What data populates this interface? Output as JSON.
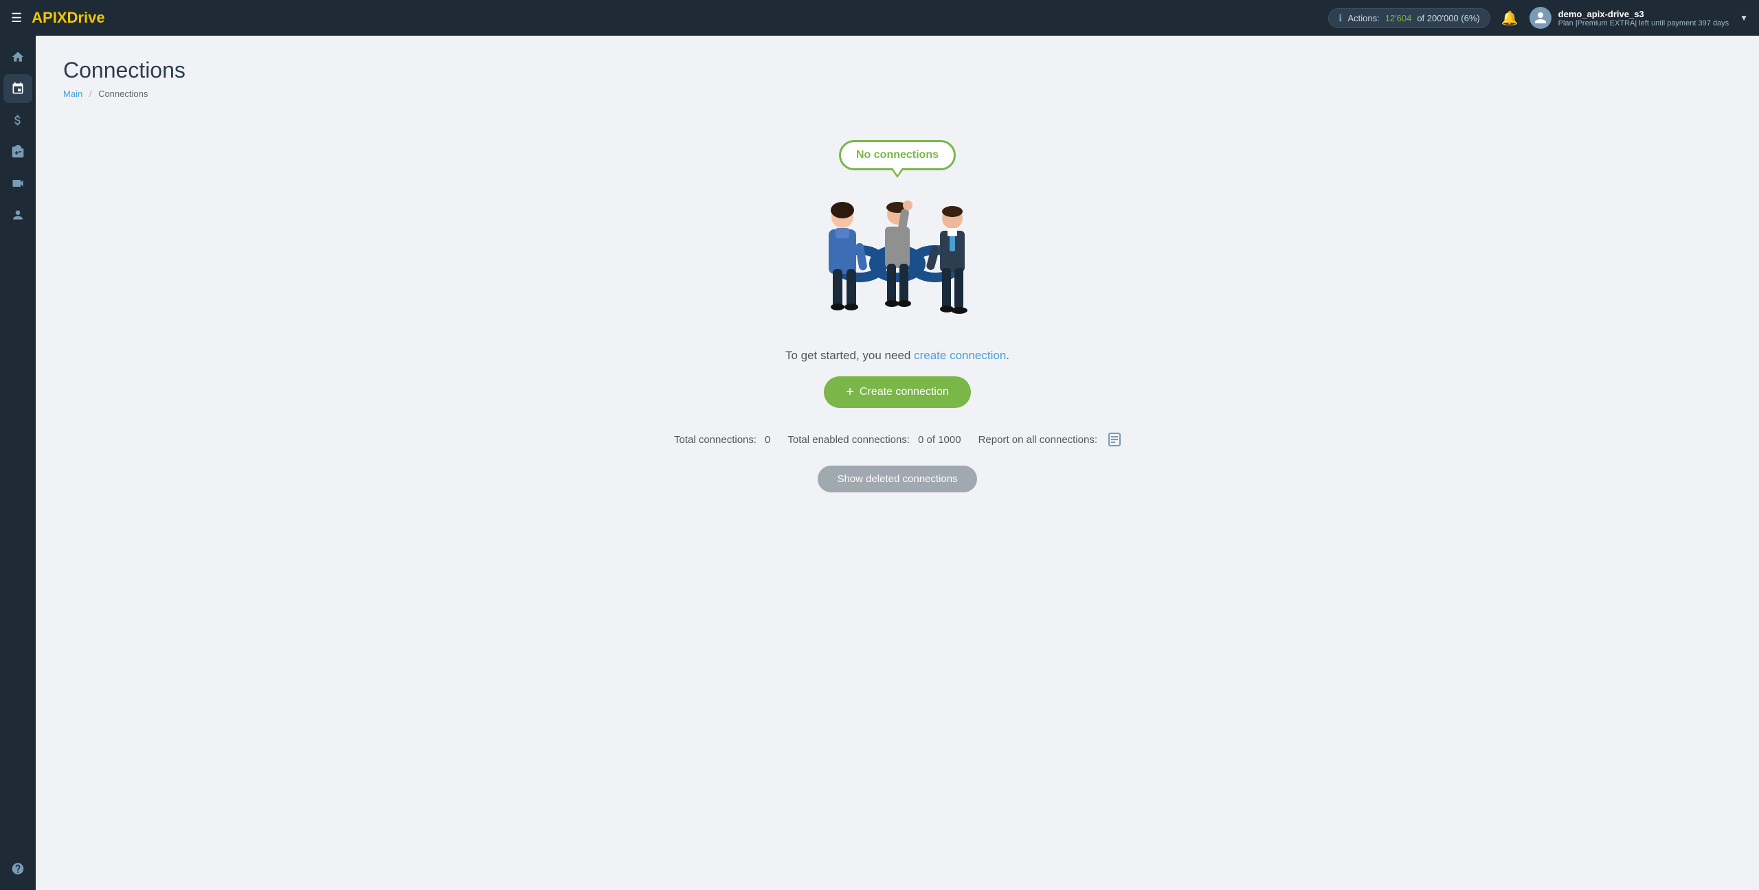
{
  "topnav": {
    "logo": "APIXDrive",
    "logo_api": "API",
    "logo_x": "X",
    "logo_drive": "Drive",
    "actions_label": "Actions:",
    "actions_count": "12'604",
    "actions_of": "of",
    "actions_total": "200'000",
    "actions_pct": "(6%)",
    "user_name": "demo_apix-drive_s3",
    "user_plan": "Plan |Premium EXTRA| left until payment",
    "user_days": "397 days"
  },
  "sidebar": {
    "items": [
      {
        "id": "home",
        "icon": "⌂",
        "label": "Home"
      },
      {
        "id": "connections",
        "icon": "⇌",
        "label": "Connections"
      },
      {
        "id": "billing",
        "icon": "$",
        "label": "Billing"
      },
      {
        "id": "apps",
        "icon": "⊞",
        "label": "Apps"
      },
      {
        "id": "video",
        "icon": "▶",
        "label": "Video"
      },
      {
        "id": "account",
        "icon": "👤",
        "label": "Account"
      },
      {
        "id": "help",
        "icon": "?",
        "label": "Help"
      }
    ]
  },
  "page": {
    "title": "Connections",
    "breadcrumb_main": "Main",
    "breadcrumb_sep": "/",
    "breadcrumb_current": "Connections"
  },
  "empty_state": {
    "cloud_text": "No connections",
    "message_prefix": "To get started, you need",
    "message_link": "create connection",
    "message_suffix": ".",
    "create_btn_icon": "+",
    "create_btn_label": "Create connection",
    "total_label": "Total connections:",
    "total_value": "0",
    "enabled_label": "Total enabled connections:",
    "enabled_value": "0 of 1000",
    "report_label": "Report on all connections:",
    "show_deleted_label": "Show deleted connections"
  }
}
